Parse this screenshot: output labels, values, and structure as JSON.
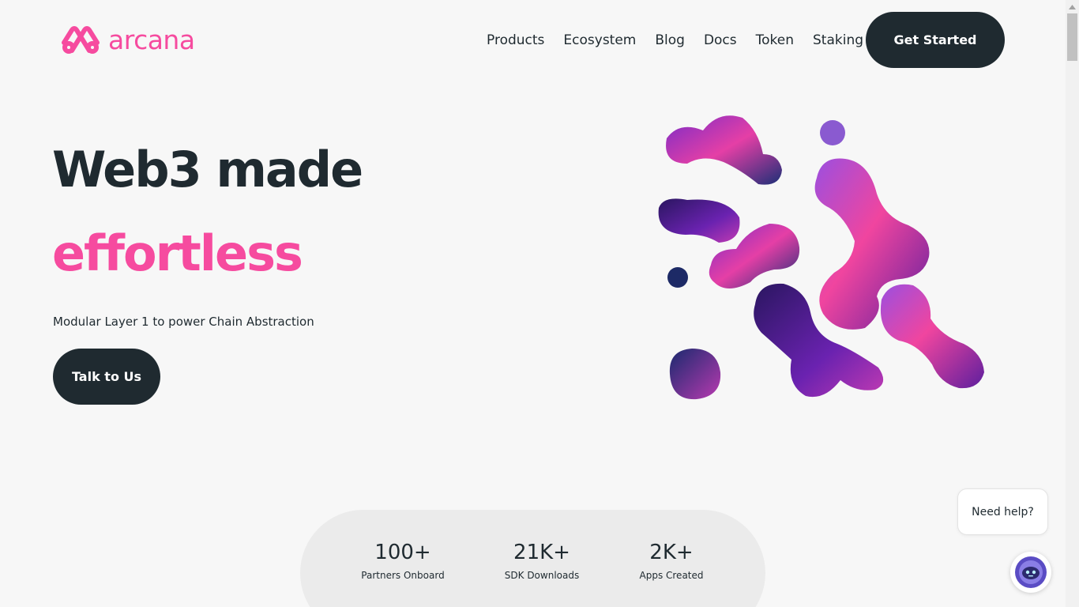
{
  "brand": {
    "name": "arcana",
    "color": "#f64b9f",
    "icon": "arcana-logo-icon"
  },
  "nav": {
    "items": [
      {
        "label": "Products"
      },
      {
        "label": "Ecosystem"
      },
      {
        "label": "Blog"
      },
      {
        "label": "Docs"
      },
      {
        "label": "Token"
      },
      {
        "label": "Staking"
      }
    ],
    "cta_label": "Get Started"
  },
  "hero": {
    "title": "Web3 made",
    "accent": "effortless",
    "subtitle": "Modular Layer 1 to power Chain Abstraction",
    "cta_label": "Talk to Us",
    "artwork_icon": "abstract-blob-art"
  },
  "stats": [
    {
      "value": "100+",
      "label": "Partners Onboard"
    },
    {
      "value": "21K+",
      "label": "SDK Downloads"
    },
    {
      "value": "2K+",
      "label": "Apps Created"
    }
  ],
  "help": {
    "label": "Need help?",
    "icon": "chat-assistant-avatar-icon"
  },
  "colors": {
    "dark": "#1f2a30",
    "accent": "#f64b9f",
    "background": "#f7f7f7"
  }
}
